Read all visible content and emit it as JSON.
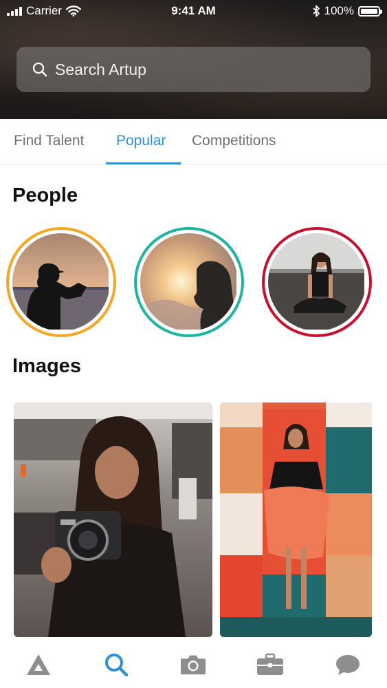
{
  "status_bar": {
    "carrier": "Carrier",
    "time": "9:41 AM",
    "battery": "100%"
  },
  "search": {
    "placeholder": "Search Artup"
  },
  "tabs": [
    {
      "label": "Find Talent",
      "active": false
    },
    {
      "label": "Popular",
      "active": true
    },
    {
      "label": "Competitions",
      "active": false
    }
  ],
  "sections": {
    "people_title": "People",
    "images_title": "Images"
  },
  "people": [
    {
      "name": "person-photographer-silhouette",
      "ring_color": "#f5a623"
    },
    {
      "name": "person-sunset-profile",
      "ring_color": "#1db59f"
    },
    {
      "name": "person-beach-sitting",
      "ring_color": "#c8102e"
    }
  ],
  "nav": [
    {
      "icon": "artup-logo-icon",
      "active": false
    },
    {
      "icon": "search-icon",
      "active": true
    },
    {
      "icon": "camera-icon",
      "active": false
    },
    {
      "icon": "briefcase-icon",
      "active": false
    },
    {
      "icon": "chat-icon",
      "active": false
    }
  ],
  "colors": {
    "accent": "#2f8fd8",
    "inactive_tab": "#6e6e6e",
    "nav_inactive": "#8e8e8e"
  }
}
